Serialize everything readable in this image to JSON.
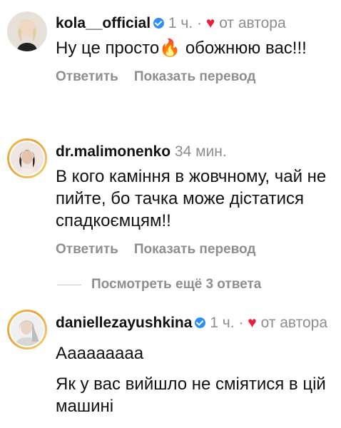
{
  "comments": [
    {
      "username": "kola__official",
      "time": "1 ч.",
      "separator": "·",
      "author_heart": "♥",
      "author_label": "от автора",
      "text_before_emoji": "Ну це просто",
      "emoji": "🔥",
      "text_after_emoji": " обожнюю вас!!!",
      "reply_label": "Ответить",
      "translate_label": "Показать перевод"
    },
    {
      "username": "dr.malimonenko",
      "time": "34 мин.",
      "text": "В кого каміння в жовчному, чай не пийте, бо тачка може дістатися спадкоємцям!!",
      "reply_label": "Ответить",
      "translate_label": "Показать перевод"
    },
    {
      "username": "daniellezayushkina",
      "time": "1 ч.",
      "separator": "·",
      "author_heart": "♥",
      "author_label": "от автора",
      "text_line1": "Ааааааааа",
      "text_line2": "Як у вас вийшло не сміятися в цій машині"
    }
  ],
  "replies": {
    "label": "Посмотреть ещё 3 ответа"
  },
  "colors": {
    "verified_badge": "#2c8ef8",
    "heart": "#ed1c3e",
    "muted_text": "#8e8e8e",
    "story_ring": "#f4c04a"
  }
}
